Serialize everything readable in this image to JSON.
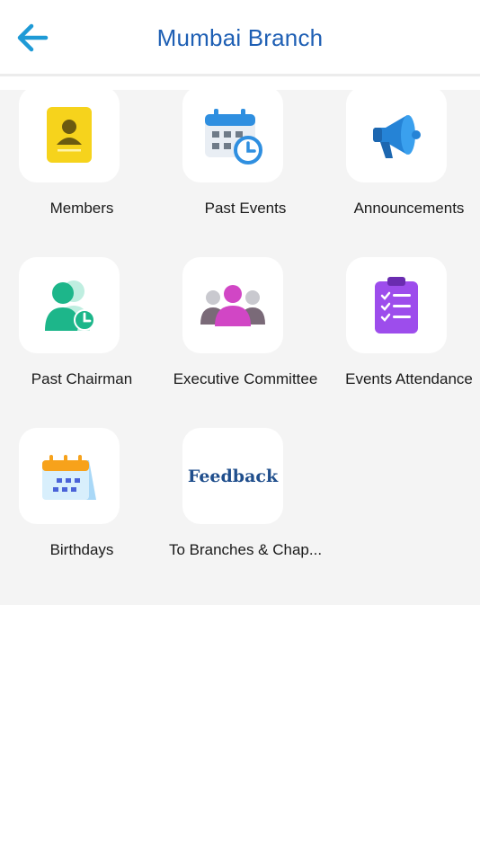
{
  "header": {
    "back_icon": "arrow-left-icon",
    "title": "Mumbai Branch",
    "accent_color": "#1e5fb4"
  },
  "grid": {
    "items": [
      {
        "label": "Members",
        "icon": "member-id-card-icon"
      },
      {
        "label": "Past Events",
        "icon": "calendar-clock-icon"
      },
      {
        "label": "Announcements",
        "icon": "megaphone-icon"
      },
      {
        "label": "Past Chairman",
        "icon": "person-clock-icon"
      },
      {
        "label": "Executive Committee",
        "icon": "group-people-icon"
      },
      {
        "label": "Events Attendance",
        "icon": "clipboard-checklist-icon"
      },
      {
        "label": "Birthdays",
        "icon": "birthday-calendar-icon"
      },
      {
        "label": "To Branches & Chap...",
        "icon": "feedback-text-icon",
        "icon_text": "Feedback"
      }
    ]
  }
}
